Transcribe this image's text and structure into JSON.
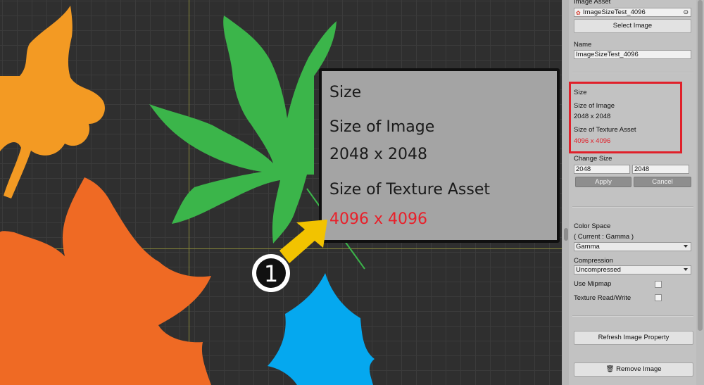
{
  "callout": {
    "size_label": "Size",
    "size_of_image_label": "Size of Image",
    "size_of_image_value": "2048 x 2048",
    "size_of_texture_label": "Size of Texture Asset",
    "size_of_texture_value": "4096 x 4096",
    "marker_number": "1"
  },
  "inspector": {
    "image_asset_label": "Image Asset",
    "image_asset_value": "ImageSizeTest_4096",
    "select_image_button": "Select Image",
    "name_label": "Name",
    "name_value": "ImageSizeTest_4096",
    "size_label": "Size",
    "size_of_image_label": "Size of Image",
    "size_of_image_value": "2048 x 2048",
    "size_of_texture_label": "Size of Texture Asset",
    "size_of_texture_value": "4096 x 4096",
    "change_size_label": "Change Size",
    "change_width_value": "2048",
    "change_height_value": "2048",
    "apply_button": "Apply",
    "cancel_button": "Cancel",
    "color_space_label": "Color Space",
    "color_space_current": "( Current : Gamma )",
    "color_space_value": "Gamma",
    "compression_label": "Compression",
    "compression_value": "Uncompressed",
    "use_mipmap_label": "Use Mipmap",
    "texture_rw_label": "Texture Read/Write",
    "refresh_button": "Refresh Image Property",
    "remove_button": "Remove Image"
  },
  "colors": {
    "highlight": "#e0202a",
    "texture_value_red": "#e8202a",
    "pointer_yellow": "#f2c300",
    "leaf_orange_light": "#f39a23",
    "leaf_orange_dark": "#ef6a24",
    "leaf_green": "#3bb54a",
    "leaf_blue": "#05a8ef"
  }
}
